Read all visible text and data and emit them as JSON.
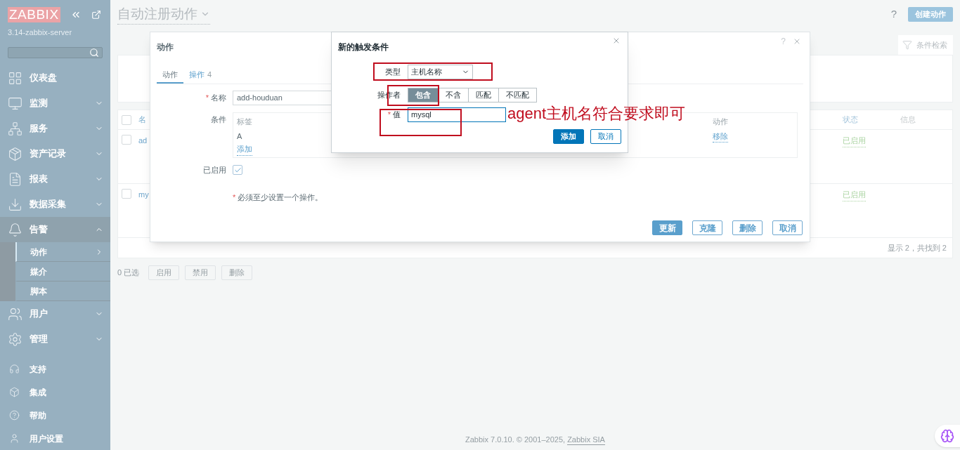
{
  "sidebar": {
    "logo": "ZABBIX",
    "server": "3.14-zabbix-server",
    "menu": [
      {
        "label": "仪表盘",
        "kind": "link"
      },
      {
        "label": "监测",
        "kind": "group",
        "expanded": false
      },
      {
        "label": "服务",
        "kind": "group",
        "expanded": false
      },
      {
        "label": "资产记录",
        "kind": "group",
        "expanded": false
      },
      {
        "label": "报表",
        "kind": "group",
        "expanded": false
      },
      {
        "label": "数据采集",
        "kind": "group",
        "expanded": false
      },
      {
        "label": "告警",
        "kind": "group",
        "expanded": true,
        "children": [
          {
            "label": "动作",
            "selected": true
          },
          {
            "label": "媒介",
            "selected": false
          },
          {
            "label": "脚本",
            "selected": false
          }
        ]
      },
      {
        "label": "用户",
        "kind": "group",
        "expanded": false
      },
      {
        "label": "管理",
        "kind": "group",
        "expanded": false
      }
    ],
    "bottom_menu": [
      "支持",
      "集成",
      "帮助",
      "用户设置"
    ]
  },
  "header": {
    "title": "自动注册动作",
    "help": "?",
    "create_button": "创建动作"
  },
  "filter": {
    "tab": "条件检索"
  },
  "table": {
    "all_checked": false,
    "columns": [
      "名",
      "状态",
      "信息"
    ],
    "rows": [
      {
        "checked": false,
        "name": "ad",
        "status": "已启用"
      },
      {
        "checked": false,
        "name": "my",
        "status": "已启用"
      }
    ],
    "summary": "显示 2，共找到 2"
  },
  "mass_actions": {
    "selected": "0 已选",
    "buttons": [
      "启用",
      "禁用",
      "删除"
    ]
  },
  "footer": {
    "text": "Zabbix 7.0.10. © 2001–2025, ",
    "link": "Zabbix SIA"
  },
  "action_dialog": {
    "title": "动作",
    "help": "?",
    "tabs": [
      {
        "label": "动作",
        "selected": true
      },
      {
        "label": "操作",
        "count": "4",
        "selected": false
      }
    ],
    "required_mark": "*",
    "name_label": "名称",
    "name_value": "add-houduan",
    "conditions_label": "条件",
    "conditions_columns": [
      "标签",
      "动作"
    ],
    "conditions_rows": [
      {
        "tag": "A",
        "action": "移除"
      }
    ],
    "add_link": "添加",
    "enabled_label": "已启用",
    "enabled": true,
    "note_mark": "*",
    "note": "必须至少设置一个操作。",
    "buttons": [
      {
        "label": "更新",
        "kind": "primary"
      },
      {
        "label": "克隆",
        "kind": "secondary"
      },
      {
        "label": "删除",
        "kind": "secondary"
      },
      {
        "label": "取消",
        "kind": "secondary"
      }
    ]
  },
  "condition_dialog": {
    "title": "新的触发条件",
    "type_label": "类型",
    "type_value": "主机名称",
    "operator_label": "操作者",
    "operators": [
      {
        "label": "包含",
        "selected": true
      },
      {
        "label": "不含",
        "selected": false
      },
      {
        "label": "匹配",
        "selected": false
      },
      {
        "label": "不匹配",
        "selected": false
      }
    ],
    "value_required_mark": "*",
    "value_label": "值",
    "value": "mysql",
    "buttons": [
      {
        "label": "添加",
        "kind": "primary"
      },
      {
        "label": "取消",
        "kind": "secondary"
      }
    ]
  },
  "annotation": {
    "note": "agent主机名符合要求即可"
  }
}
